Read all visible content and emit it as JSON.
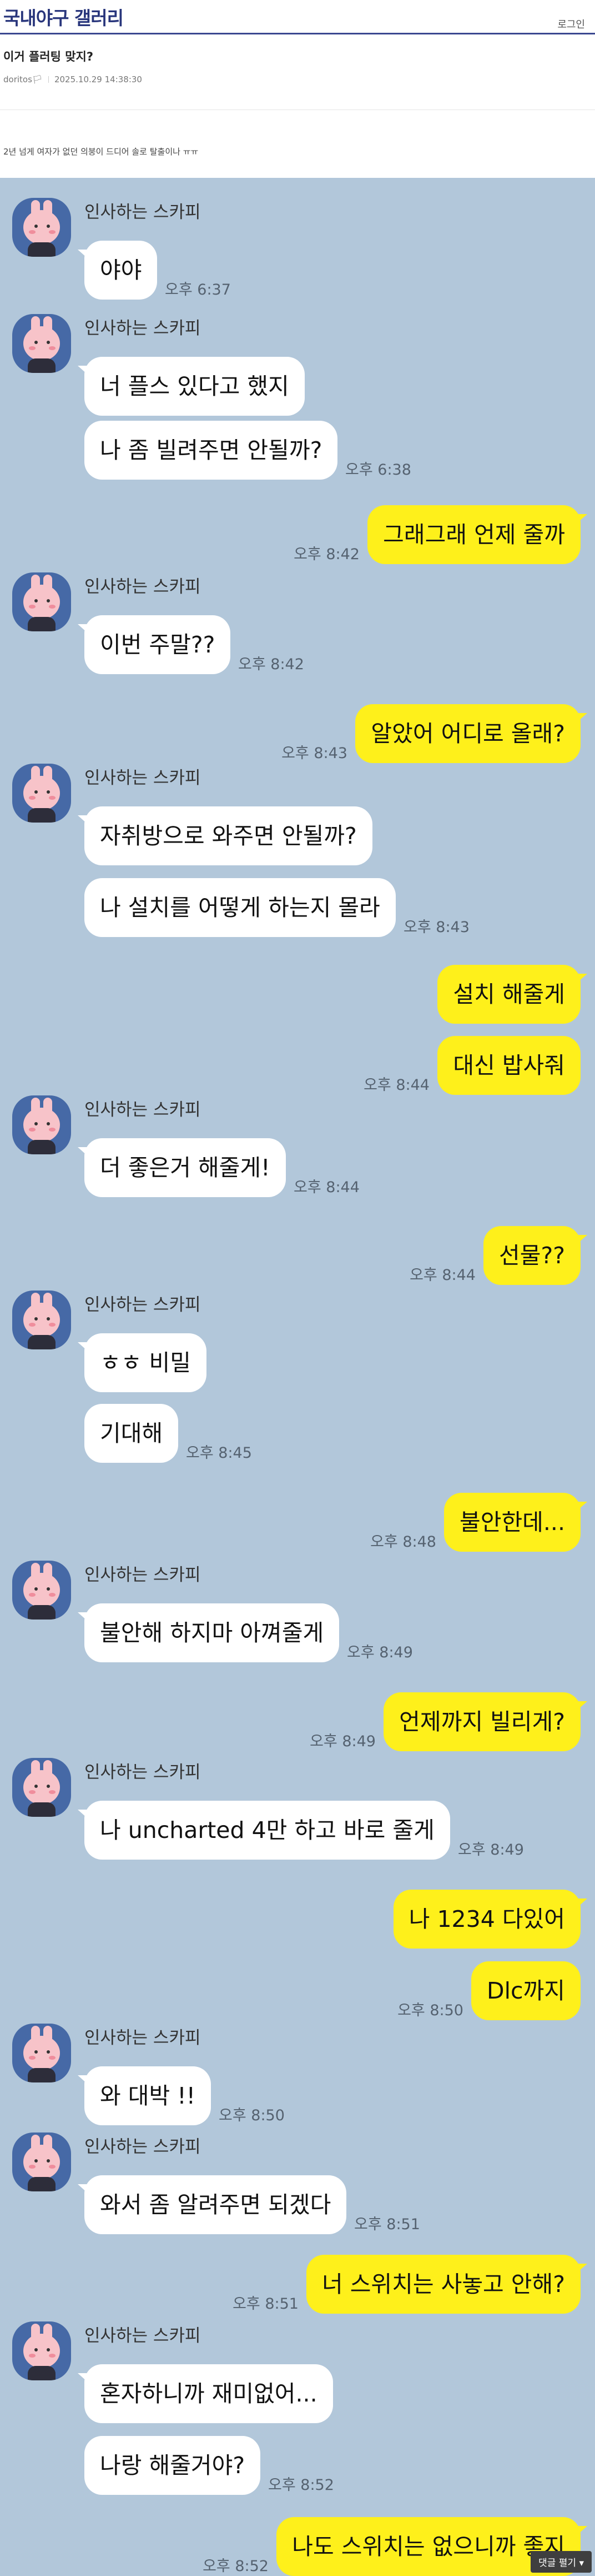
{
  "header": {
    "gallery_title": "국내야구 갤러리",
    "login": "로그인"
  },
  "post": {
    "title": "이거 플러팅 맞지?",
    "author": "doritos🏳",
    "datetime": "2025.10.29 14:38:30",
    "body": "2년 넘게 여자가 없던 의붕이 드디어 솔로 탈출이나 ㅠㅠ"
  },
  "chat": {
    "partner_name": "인사하는 스카피",
    "messages": [
      {
        "side": "in",
        "text": "야야",
        "time": "오후 6:37"
      },
      {
        "side": "in",
        "text": "너 플스 있다고 했지",
        "time": ""
      },
      {
        "side": "in",
        "text": "나 좀 빌려주면 안될까?",
        "time": "오후 6:38"
      },
      {
        "side": "out",
        "text": "그래그래 언제 줄까",
        "time": "오후 8:42"
      },
      {
        "side": "in",
        "text": "이번 주말??",
        "time": "오후 8:42"
      },
      {
        "side": "out",
        "text": "알았어 어디로 올래?",
        "time": "오후 8:43"
      },
      {
        "side": "in",
        "text": "자취방으로 와주면 안될까?",
        "time": ""
      },
      {
        "side": "in",
        "text": "나 설치를 어떻게 하는지 몰라",
        "time": "오후 8:43"
      },
      {
        "side": "out",
        "text": "설치 해줄게",
        "time": ""
      },
      {
        "side": "out",
        "text": "대신 밥사줘",
        "time": "오후 8:44"
      },
      {
        "side": "in",
        "text": "더 좋은거 해줄게!",
        "time": "오후 8:44"
      },
      {
        "side": "out",
        "text": "선물??",
        "time": "오후 8:44"
      },
      {
        "side": "in",
        "text": "ㅎㅎ 비밀",
        "time": ""
      },
      {
        "side": "in",
        "text": "기대해",
        "time": "오후 8:45"
      },
      {
        "side": "out",
        "text": "불안한데...",
        "time": "오후 8:48"
      },
      {
        "side": "in",
        "text": "불안해 하지마 아껴줄게",
        "time": "오후 8:49"
      },
      {
        "side": "out",
        "text": "언제까지 빌리게?",
        "time": "오후 8:49"
      },
      {
        "side": "in",
        "text": "나 uncharted 4만 하고 바로 줄게",
        "time": "오후 8:49"
      },
      {
        "side": "out",
        "text": "나 1234 다있어",
        "time": ""
      },
      {
        "side": "out",
        "text": "Dlc까지",
        "time": "오후 8:50"
      },
      {
        "side": "in",
        "text": "와 대박 !!",
        "time": "오후 8:50"
      },
      {
        "side": "in",
        "text": "와서 좀 알려주면 되겠다",
        "time": "오후 8:51"
      },
      {
        "side": "out",
        "text": "너 스위치는 사놓고 안해?",
        "time": "오후 8:51"
      },
      {
        "side": "in",
        "text": "혼자하니까 재미없어...",
        "time": ""
      },
      {
        "side": "in",
        "text": "나랑 해줄거야?",
        "time": "오후 8:52"
      },
      {
        "side": "out",
        "text": "나도 스위치는 없으니까 좋지",
        "time": "오후 8:52"
      }
    ]
  },
  "footer": {
    "comment_button": "댓글 펼기 ▾"
  }
}
